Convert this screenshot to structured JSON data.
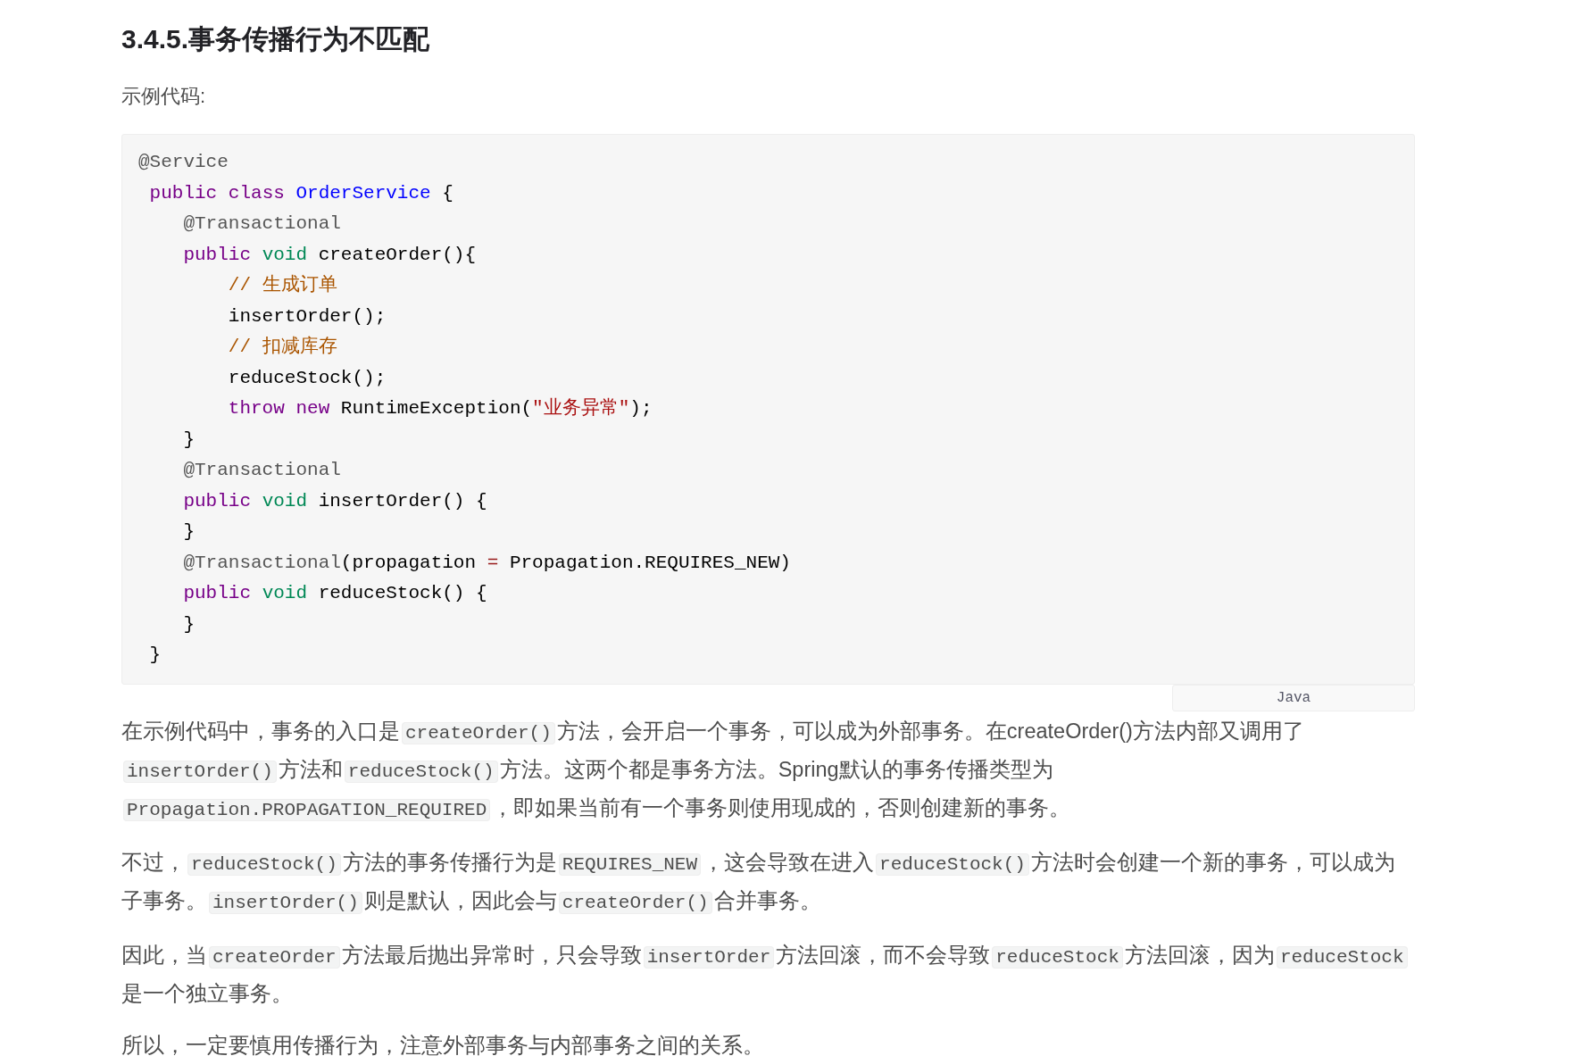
{
  "heading": "3.4.5.事务传播行为不匹配",
  "intro": "示例代码:",
  "code_block": {
    "language": "Java",
    "lines": [
      [
        {
          "kind": "annotation",
          "text": "@Service"
        }
      ],
      [
        {
          "kind": "keyword",
          "text": " public "
        },
        {
          "kind": "keyword",
          "text": "class "
        },
        {
          "kind": "classname",
          "text": "OrderService"
        },
        {
          "kind": "plain",
          "text": " {"
        }
      ],
      [
        {
          "kind": "annotation",
          "text": "    @Transactional"
        }
      ],
      [
        {
          "kind": "keyword",
          "text": "    public "
        },
        {
          "kind": "type",
          "text": "void"
        },
        {
          "kind": "plain",
          "text": " createOrder(){"
        }
      ],
      [
        {
          "kind": "comment",
          "text": "        // 生成订单"
        }
      ],
      [
        {
          "kind": "plain",
          "text": "        insertOrder();"
        }
      ],
      [
        {
          "kind": "comment",
          "text": "        // 扣减库存"
        }
      ],
      [
        {
          "kind": "plain",
          "text": "        reduceStock();"
        }
      ],
      [
        {
          "kind": "keyword",
          "text": "        throw "
        },
        {
          "kind": "keyword",
          "text": "new"
        },
        {
          "kind": "plain",
          "text": " RuntimeException("
        },
        {
          "kind": "string",
          "text": "\"业务异常\""
        },
        {
          "kind": "plain",
          "text": ");"
        }
      ],
      [
        {
          "kind": "plain",
          "text": "    }"
        }
      ],
      [
        {
          "kind": "annotation",
          "text": "    @Transactional"
        }
      ],
      [
        {
          "kind": "keyword",
          "text": "    public "
        },
        {
          "kind": "type",
          "text": "void"
        },
        {
          "kind": "plain",
          "text": " insertOrder() {"
        }
      ],
      [
        {
          "kind": "plain",
          "text": "    }"
        }
      ],
      [
        {
          "kind": "annotation",
          "text": "    @Transactional"
        },
        {
          "kind": "plain",
          "text": "(propagation "
        },
        {
          "kind": "operator",
          "text": "="
        },
        {
          "kind": "plain",
          "text": " Propagation.REQUIRES_NEW)"
        }
      ],
      [
        {
          "kind": "keyword",
          "text": "    public "
        },
        {
          "kind": "type",
          "text": "void"
        },
        {
          "kind": "plain",
          "text": " reduceStock() {"
        }
      ],
      [
        {
          "kind": "plain",
          "text": "    }"
        }
      ],
      [
        {
          "kind": "plain",
          "text": " }"
        }
      ]
    ]
  },
  "paragraphs": [
    [
      {
        "kind": "text",
        "text": "在示例代码中，事务的入口是"
      },
      {
        "kind": "code",
        "text": "createOrder()"
      },
      {
        "kind": "text",
        "text": "方法，会开启一个事务，可以成为外部事务。在createOrder()方法内部又调用了"
      },
      {
        "kind": "code",
        "text": "insertOrder()"
      },
      {
        "kind": "text",
        "text": "方法和"
      },
      {
        "kind": "code",
        "text": "reduceStock()"
      },
      {
        "kind": "text",
        "text": "方法。这两个都是事务方法。Spring默认的事务传播类型为"
      },
      {
        "kind": "code",
        "text": "Propagation.PROPAGATION_REQUIRED"
      },
      {
        "kind": "text",
        "text": "，即如果当前有一个事务则使用现成的，否则创建新的事务。"
      }
    ],
    [
      {
        "kind": "text",
        "text": "不过，"
      },
      {
        "kind": "code",
        "text": "reduceStock()"
      },
      {
        "kind": "text",
        "text": "方法的事务传播行为是"
      },
      {
        "kind": "code",
        "text": "REQUIRES_NEW"
      },
      {
        "kind": "text",
        "text": "，这会导致在进入"
      },
      {
        "kind": "code",
        "text": "reduceStock()"
      },
      {
        "kind": "text",
        "text": "方法时会创建一个新的事务，可以成为子事务。"
      },
      {
        "kind": "code",
        "text": "insertOrder()"
      },
      {
        "kind": "text",
        "text": "则是默认，因此会与"
      },
      {
        "kind": "code",
        "text": "createOrder()"
      },
      {
        "kind": "text",
        "text": "合并事务。"
      }
    ],
    [
      {
        "kind": "text",
        "text": "因此，当"
      },
      {
        "kind": "code",
        "text": "createOrder"
      },
      {
        "kind": "text",
        "text": "方法最后抛出异常时，只会导致"
      },
      {
        "kind": "code",
        "text": "insertOrder"
      },
      {
        "kind": "text",
        "text": "方法回滚，而不会导致"
      },
      {
        "kind": "code",
        "text": "reduceStock"
      },
      {
        "kind": "text",
        "text": "方法回滚，因为"
      },
      {
        "kind": "code",
        "text": "reduceStock"
      },
      {
        "kind": "text",
        "text": "是一个独立事务。"
      }
    ],
    [
      {
        "kind": "text",
        "text": "所以，一定要慎用传播行为，注意外部事务与内部事务之间的关系。"
      }
    ]
  ]
}
